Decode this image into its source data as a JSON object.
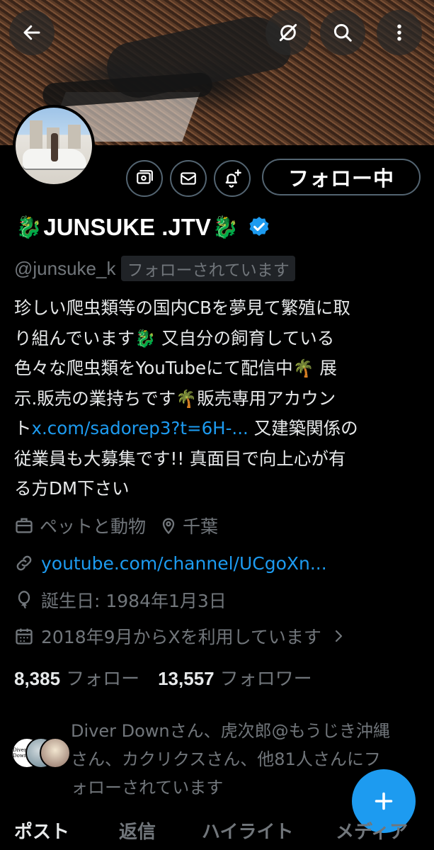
{
  "header": {
    "back_icon": "arrow-left-icon",
    "icons": [
      "repost-off-icon",
      "search-icon",
      "more-vertical-icon"
    ]
  },
  "actions": {
    "icons": [
      "subscribe-icon",
      "message-icon",
      "notification-add-icon"
    ],
    "follow_label": "フォロー中"
  },
  "profile": {
    "name": "JUNSUKE .JTV",
    "name_emoji": "🐉",
    "verified": true,
    "handle": "@junsuke_k",
    "follows_you": "フォローされています"
  },
  "bio": {
    "line1": "珍しい爬虫類等の国内CBを夢見て繁殖に取",
    "line2a": "り組んでいます",
    "line2b": " 又自分の飼育している",
    "line3a": "色々な爬虫類をYouTubeにて配信中",
    "line3b": " 展",
    "line4a": "示.販売の業持ちです",
    "line4b": "販売専用アカウン",
    "line5a": "ト",
    "line5_link": "x.com/sadorep3?t=6H-...",
    "line5b": " 又建築関係の",
    "line6": "従業員も大募集です!! 真面目で向上心が有",
    "line7": "る方DM下さい",
    "palm": "🌴",
    "dragon": "🐉"
  },
  "meta": {
    "category": "ペットと動物",
    "location": "千葉",
    "website": "youtube.com/channel/UCgoXn...",
    "birthday": "誕生日: 1984年1月3日",
    "joined": "2018年9月からXを利用しています"
  },
  "counts": {
    "following_count": "8,385",
    "following_label": "フォロー",
    "followers_count": "13,557",
    "followers_label": "フォロワー"
  },
  "followed_by": {
    "line1": "Diver Downさん、虎次郎@もうじき沖縄",
    "line2": "さん、カクリクスさん、他81人さんにフ",
    "line3": "ォローされています",
    "avatar_text": "Diver Down"
  },
  "tabs": [
    "ポスト",
    "返信",
    "ハイライト",
    "メディア"
  ],
  "colors": {
    "accent": "#1d9bf0",
    "muted": "#71767b",
    "text": "#e7e9ea",
    "background": "#000000"
  }
}
